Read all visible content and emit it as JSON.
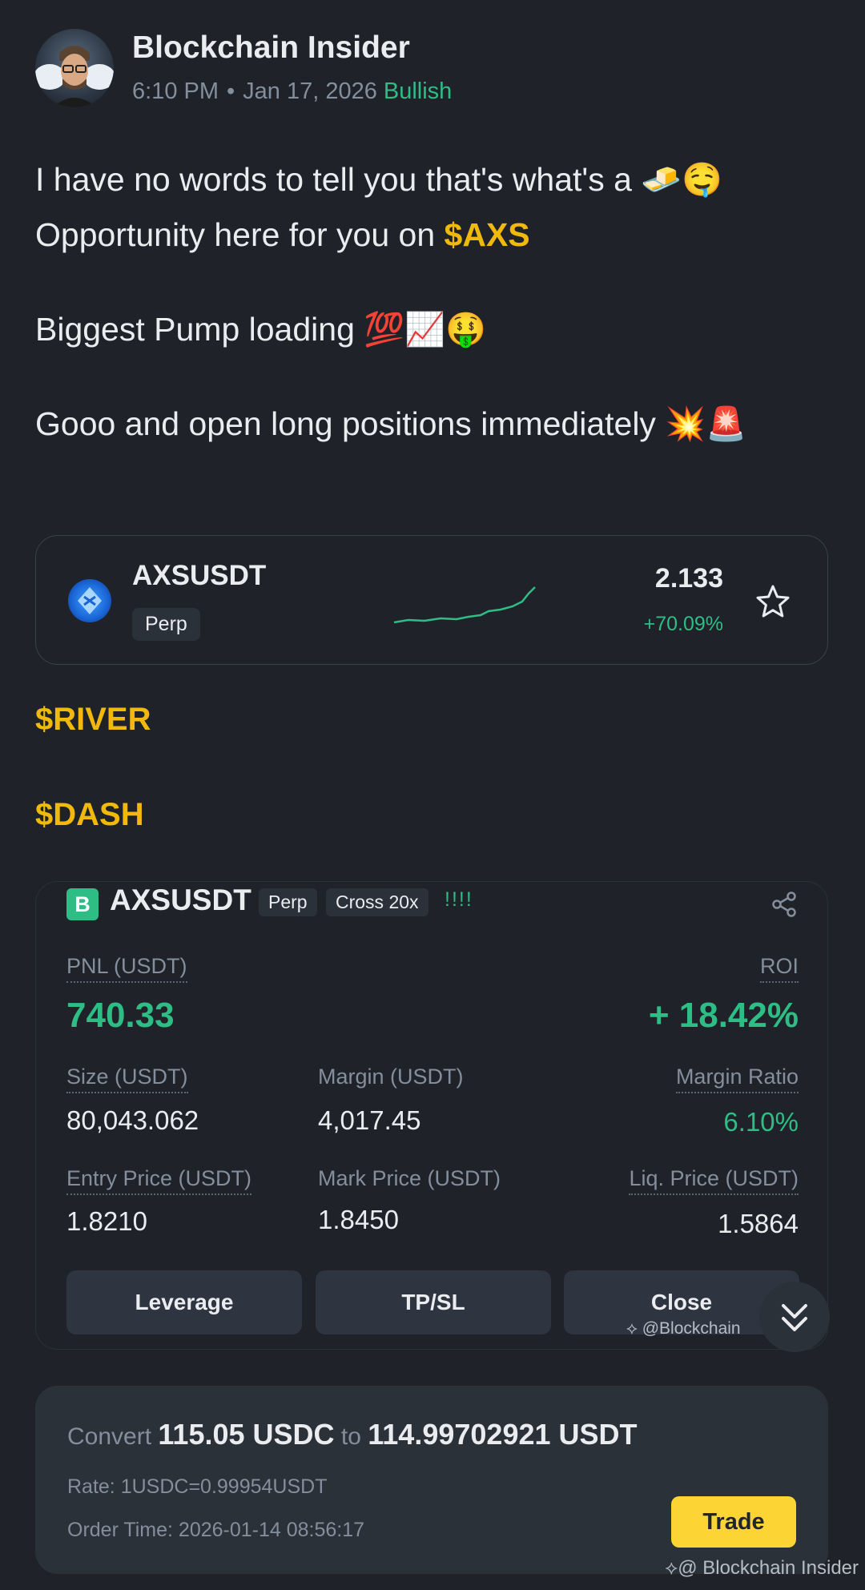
{
  "post": {
    "author": "Blockchain Insider",
    "time": "6:10 PM",
    "date": "Jan 17, 2026",
    "sentiment": "Bullish",
    "line1": "I have no words to tell you that's what's a 🧈🤤",
    "line2a": "Opportunity here for you on ",
    "line2_tag": "$AXS",
    "para2": "Biggest Pump loading 💯📈🤑",
    "para3": "Gooo and open long positions immediately 💥🚨",
    "tag_river": "$RIVER",
    "tag_dash": "$DASH"
  },
  "ticker_card": {
    "symbol": "AXSUSDT",
    "type": "Perp",
    "price": "2.133",
    "change": "+70.09%"
  },
  "position": {
    "side_badge": "B",
    "symbol": "AXSUSDT",
    "type": "Perp",
    "margin_mode": "Cross 20x",
    "excl": "!!!!",
    "pnl_label": "PNL (USDT)",
    "pnl": "740.33",
    "roi_label": "ROI",
    "roi": "+ 18.42%",
    "size_label": "Size (USDT)",
    "size": "80,043.062",
    "margin_label": "Margin (USDT)",
    "margin": "4,017.45",
    "ratio_label": "Margin Ratio",
    "ratio": "6.10%",
    "entry_label": "Entry Price (USDT)",
    "entry": "1.8210",
    "mark_label": "Mark Price (USDT)",
    "mark": "1.8450",
    "liq_label": "Liq. Price (USDT)",
    "liq": "1.5864",
    "btn_leverage": "Leverage",
    "btn_tpsl": "TP/SL",
    "btn_close": "Close",
    "watermark": "@Blockchain"
  },
  "convert": {
    "convert_word": "Convert",
    "from_amount": "115.05 USDC",
    "to_word": "to",
    "to_amount": "114.99702921 USDT",
    "rate": "Rate: 1USDC=0.99954USDT",
    "order_time": "Order Time: 2026-01-14 08:56:17",
    "trade_label": "Trade"
  },
  "footer_watermark": "@ Blockchain Insider",
  "colors": {
    "accent": "#f0b90b",
    "positive": "#2ebd85",
    "button_yellow": "#fcd535",
    "bg": "#1f2329"
  }
}
